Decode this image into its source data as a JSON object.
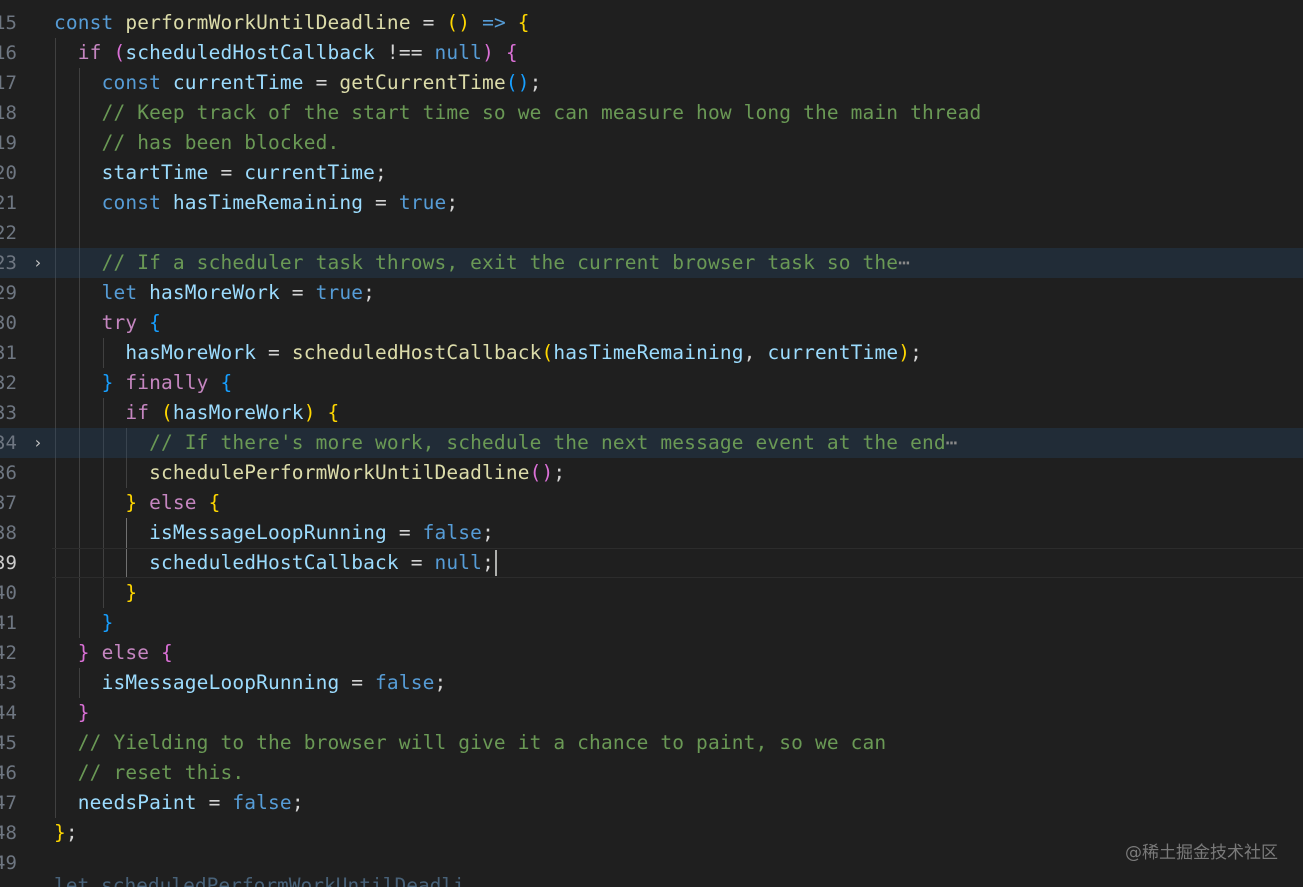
{
  "editor": {
    "lines": [
      {
        "num": "15",
        "folded": false,
        "tokens": [
          {
            "t": "const ",
            "c": "k"
          },
          {
            "t": "performWorkUntilDeadline",
            "c": "f"
          },
          {
            "t": " = ",
            "c": "p"
          },
          {
            "t": "()",
            "c": "b1"
          },
          {
            "t": " ",
            "c": "p"
          },
          {
            "t": "=>",
            "c": "k"
          },
          {
            "t": " ",
            "c": "p"
          },
          {
            "t": "{",
            "c": "b1"
          }
        ]
      },
      {
        "num": "16",
        "folded": false,
        "tokens": [
          {
            "t": "  "
          },
          {
            "t": "if ",
            "c": "kc"
          },
          {
            "t": "(",
            "c": "b2"
          },
          {
            "t": "scheduledHostCallback",
            "c": "v"
          },
          {
            "t": " !== ",
            "c": "p"
          },
          {
            "t": "null",
            "c": "k"
          },
          {
            "t": ")",
            "c": "b2"
          },
          {
            "t": " ",
            "c": "p"
          },
          {
            "t": "{",
            "c": "b2"
          }
        ]
      },
      {
        "num": "17",
        "folded": false,
        "tokens": [
          {
            "t": "    "
          },
          {
            "t": "const ",
            "c": "k"
          },
          {
            "t": "currentTime",
            "c": "v"
          },
          {
            "t": " = ",
            "c": "p"
          },
          {
            "t": "getCurrentTime",
            "c": "f"
          },
          {
            "t": "()",
            "c": "b3"
          },
          {
            "t": ";",
            "c": "p"
          }
        ]
      },
      {
        "num": "18",
        "folded": false,
        "tokens": [
          {
            "t": "    "
          },
          {
            "t": "// Keep track of the start time so we can measure how long the main thread",
            "c": "c"
          }
        ]
      },
      {
        "num": "19",
        "folded": false,
        "tokens": [
          {
            "t": "    "
          },
          {
            "t": "// has been blocked.",
            "c": "c"
          }
        ]
      },
      {
        "num": "20",
        "folded": false,
        "tokens": [
          {
            "t": "    "
          },
          {
            "t": "startTime",
            "c": "v"
          },
          {
            "t": " = ",
            "c": "p"
          },
          {
            "t": "currentTime",
            "c": "v"
          },
          {
            "t": ";",
            "c": "p"
          }
        ]
      },
      {
        "num": "21",
        "folded": false,
        "tokens": [
          {
            "t": "    "
          },
          {
            "t": "const ",
            "c": "k"
          },
          {
            "t": "hasTimeRemaining",
            "c": "v"
          },
          {
            "t": " = ",
            "c": "p"
          },
          {
            "t": "true",
            "c": "k"
          },
          {
            "t": ";",
            "c": "p"
          }
        ]
      },
      {
        "num": "22",
        "folded": false,
        "tokens": []
      },
      {
        "num": "23",
        "folded": true,
        "tokens": [
          {
            "t": "    "
          },
          {
            "t": "// If a scheduler task throws, exit the current browser task so the",
            "c": "c"
          },
          {
            "t": "⋯",
            "c": "ell"
          }
        ]
      },
      {
        "num": "29",
        "folded": false,
        "tokens": [
          {
            "t": "    "
          },
          {
            "t": "let ",
            "c": "k"
          },
          {
            "t": "hasMoreWork",
            "c": "v"
          },
          {
            "t": " = ",
            "c": "p"
          },
          {
            "t": "true",
            "c": "k"
          },
          {
            "t": ";",
            "c": "p"
          }
        ]
      },
      {
        "num": "30",
        "folded": false,
        "tokens": [
          {
            "t": "    "
          },
          {
            "t": "try ",
            "c": "kc"
          },
          {
            "t": "{",
            "c": "b3"
          }
        ]
      },
      {
        "num": "31",
        "folded": false,
        "tokens": [
          {
            "t": "      "
          },
          {
            "t": "hasMoreWork",
            "c": "v"
          },
          {
            "t": " = ",
            "c": "p"
          },
          {
            "t": "scheduledHostCallback",
            "c": "f"
          },
          {
            "t": "(",
            "c": "b1"
          },
          {
            "t": "hasTimeRemaining",
            "c": "v"
          },
          {
            "t": ", ",
            "c": "p"
          },
          {
            "t": "currentTime",
            "c": "v"
          },
          {
            "t": ")",
            "c": "b1"
          },
          {
            "t": ";",
            "c": "p"
          }
        ]
      },
      {
        "num": "32",
        "folded": false,
        "tokens": [
          {
            "t": "    "
          },
          {
            "t": "}",
            "c": "b3"
          },
          {
            "t": " ",
            "c": "p"
          },
          {
            "t": "finally ",
            "c": "kc"
          },
          {
            "t": "{",
            "c": "b3"
          }
        ]
      },
      {
        "num": "33",
        "folded": false,
        "tokens": [
          {
            "t": "      "
          },
          {
            "t": "if ",
            "c": "kc"
          },
          {
            "t": "(",
            "c": "b1"
          },
          {
            "t": "hasMoreWork",
            "c": "v"
          },
          {
            "t": ")",
            "c": "b1"
          },
          {
            "t": " ",
            "c": "p"
          },
          {
            "t": "{",
            "c": "b1"
          }
        ]
      },
      {
        "num": "34",
        "folded": true,
        "tokens": [
          {
            "t": "        "
          },
          {
            "t": "// If there's more work, schedule the next message event at the end",
            "c": "c"
          },
          {
            "t": "⋯",
            "c": "ell"
          }
        ]
      },
      {
        "num": "36",
        "folded": false,
        "tokens": [
          {
            "t": "        "
          },
          {
            "t": "schedulePerformWorkUntilDeadline",
            "c": "f"
          },
          {
            "t": "()",
            "c": "b2"
          },
          {
            "t": ";",
            "c": "p"
          }
        ]
      },
      {
        "num": "37",
        "folded": false,
        "tokens": [
          {
            "t": "      "
          },
          {
            "t": "}",
            "c": "b1"
          },
          {
            "t": " ",
            "c": "p"
          },
          {
            "t": "else ",
            "c": "kc"
          },
          {
            "t": "{",
            "c": "b1"
          }
        ]
      },
      {
        "num": "38",
        "folded": false,
        "tokens": [
          {
            "t": "        "
          },
          {
            "t": "isMessageLoopRunning",
            "c": "v"
          },
          {
            "t": " = ",
            "c": "p"
          },
          {
            "t": "false",
            "c": "k"
          },
          {
            "t": ";",
            "c": "p"
          }
        ]
      },
      {
        "num": "39",
        "folded": false,
        "current": true,
        "tokens": [
          {
            "t": "        "
          },
          {
            "t": "scheduledHostCallback",
            "c": "v"
          },
          {
            "t": " = ",
            "c": "p"
          },
          {
            "t": "null",
            "c": "k"
          },
          {
            "t": ";",
            "c": "p"
          }
        ]
      },
      {
        "num": "40",
        "folded": false,
        "tokens": [
          {
            "t": "      "
          },
          {
            "t": "}",
            "c": "b1"
          }
        ]
      },
      {
        "num": "41",
        "folded": false,
        "tokens": [
          {
            "t": "    "
          },
          {
            "t": "}",
            "c": "b3"
          }
        ]
      },
      {
        "num": "42",
        "folded": false,
        "tokens": [
          {
            "t": "  "
          },
          {
            "t": "}",
            "c": "b2"
          },
          {
            "t": " ",
            "c": "p"
          },
          {
            "t": "else ",
            "c": "kc"
          },
          {
            "t": "{",
            "c": "b2"
          }
        ]
      },
      {
        "num": "43",
        "folded": false,
        "tokens": [
          {
            "t": "    "
          },
          {
            "t": "isMessageLoopRunning",
            "c": "v"
          },
          {
            "t": " = ",
            "c": "p"
          },
          {
            "t": "false",
            "c": "k"
          },
          {
            "t": ";",
            "c": "p"
          }
        ]
      },
      {
        "num": "44",
        "folded": false,
        "tokens": [
          {
            "t": "  "
          },
          {
            "t": "}",
            "c": "b2"
          }
        ]
      },
      {
        "num": "45",
        "folded": false,
        "tokens": [
          {
            "t": "  "
          },
          {
            "t": "// Yielding to the browser will give it a chance to paint, so we can",
            "c": "c"
          }
        ]
      },
      {
        "num": "46",
        "folded": false,
        "tokens": [
          {
            "t": "  "
          },
          {
            "t": "// reset this.",
            "c": "c"
          }
        ]
      },
      {
        "num": "47",
        "folded": false,
        "tokens": [
          {
            "t": "  "
          },
          {
            "t": "needsPaint",
            "c": "v"
          },
          {
            "t": " = ",
            "c": "p"
          },
          {
            "t": "false",
            "c": "k"
          },
          {
            "t": ";",
            "c": "p"
          }
        ]
      },
      {
        "num": "48",
        "folded": false,
        "tokens": [
          {
            "t": "}",
            "c": "b1"
          },
          {
            "t": ";",
            "c": "p"
          }
        ]
      },
      {
        "num": "49",
        "folded": false,
        "tokens": []
      }
    ],
    "partial_next_line": "let scheduledPerformWorkUntilDeadli"
  },
  "watermark": "@稀土掘金技术社区",
  "icons": {
    "fold_glyph": "›",
    "ellipsis": "⋯"
  },
  "colors": {
    "background": "#1f1f1f",
    "keyword": "#569cd6",
    "control": "#c586c0",
    "function": "#dcdcaa",
    "variable": "#9cdcfe",
    "comment": "#6a9955",
    "bracket_level1": "#ffd700",
    "bracket_level2": "#da70d6",
    "bracket_level3": "#179fff"
  }
}
